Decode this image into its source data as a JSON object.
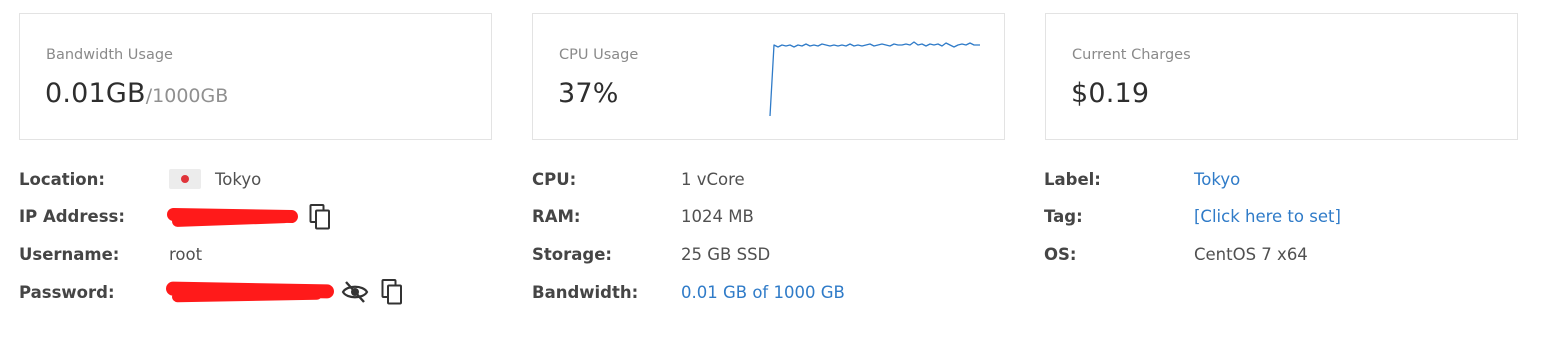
{
  "cards": {
    "bandwidth": {
      "title": "Bandwidth Usage",
      "value": "0.01GB",
      "suffix": "/1000GB"
    },
    "cpu": {
      "title": "CPU Usage",
      "value": "37%"
    },
    "charges": {
      "title": "Current Charges",
      "value": "$0.19"
    }
  },
  "left_details": {
    "location_label": "Location:",
    "location_value": "Tokyo",
    "ip_label": "IP Address:",
    "username_label": "Username:",
    "username_value": "root",
    "password_label": "Password:"
  },
  "middle_details": {
    "cpu_label": "CPU:",
    "cpu_value": "1 vCore",
    "ram_label": "RAM:",
    "ram_value": "1024 MB",
    "storage_label": "Storage:",
    "storage_value": "25 GB SSD",
    "bandwidth_label": "Bandwidth:",
    "bandwidth_value": "0.01 GB of 1000 GB"
  },
  "right_details": {
    "label_label": "Label:",
    "label_value": "Tokyo",
    "tag_label": "Tag:",
    "tag_value": "[Click here to set]",
    "os_label": "OS:",
    "os_value": "CentOS 7 x64"
  },
  "icons": {
    "flag": "japan-flag-icon",
    "copy": "copy-icon",
    "visibility": "eye-slash-icon"
  },
  "colors": {
    "link": "#2f7bc8",
    "sparkline": "#2f7bc8",
    "redaction": "#ff1a1a",
    "card_border": "#e3e3e3"
  }
}
